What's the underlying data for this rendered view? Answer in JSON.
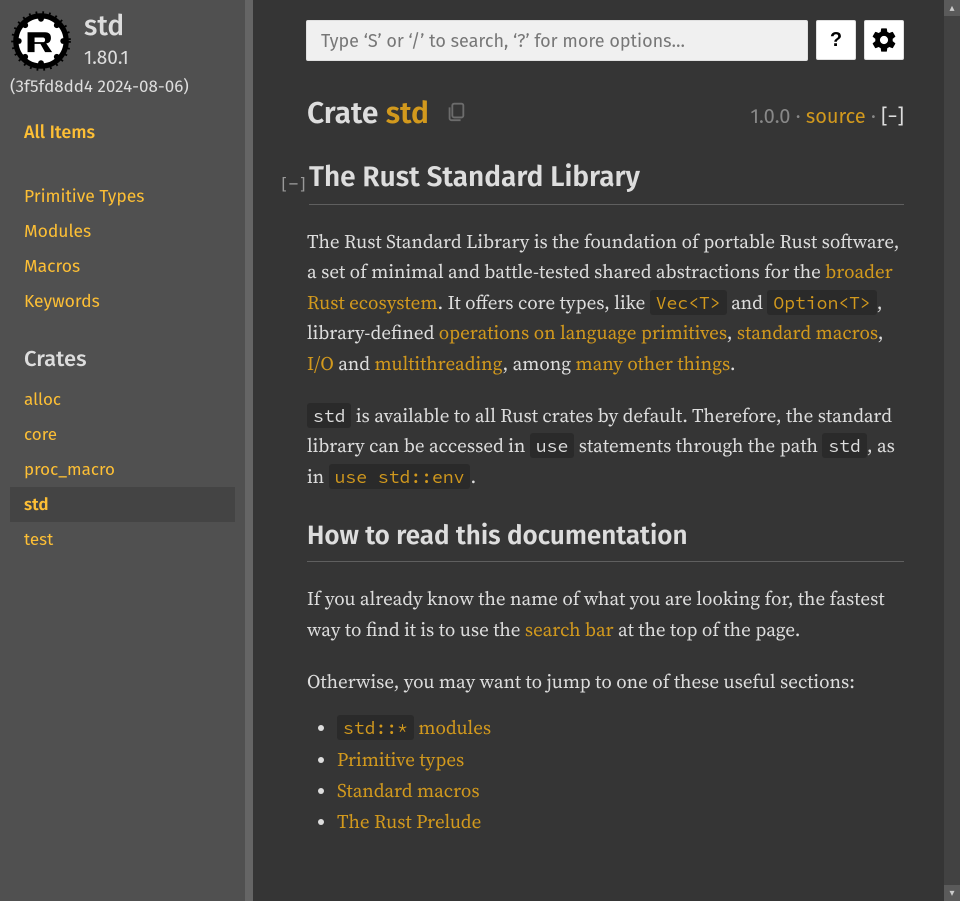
{
  "sidebar": {
    "crate_name": "std",
    "version": "1.80.1",
    "hash": "(3f5fd8dd4 2024-08-06)",
    "all_items": "All Items",
    "nav": [
      "Primitive Types",
      "Modules",
      "Macros",
      "Keywords"
    ],
    "crates_heading": "Crates",
    "crates": [
      {
        "name": "alloc",
        "current": false
      },
      {
        "name": "core",
        "current": false
      },
      {
        "name": "proc_macro",
        "current": false
      },
      {
        "name": "std",
        "current": true
      },
      {
        "name": "test",
        "current": false
      }
    ]
  },
  "topbar": {
    "search_placeholder": "Type ‘S’ or ‘/’ to search, ‘?’ for more options…",
    "help_label": "?"
  },
  "header": {
    "crate_word": "Crate",
    "crate_name": "std",
    "version": "1.0.0",
    "sep": " · ",
    "source": "source",
    "toggle": "[−]"
  },
  "doc": {
    "h1": "The Rust Standard Library",
    "p1a": "The Rust Standard Library is the foundation of portable Rust software, a set of minimal and battle-tested shared abstractions for the ",
    "link_ecosystem": "broader Rust ecosystem",
    "p1b": ". It offers core types, like ",
    "code_vec": "Vec<T>",
    "and1": " and ",
    "code_option": "Option<T>",
    "p1c": ", library-defined ",
    "link_ops": "operations on language primitives",
    "comma1": ", ",
    "link_macros": "standard macros",
    "comma2": ", ",
    "link_io": "I/O",
    "and2": " and ",
    "link_threads": "multithreading",
    "p1d": ", among ",
    "link_many": "many other things",
    "p1e": ".",
    "p2a_code": "std",
    "p2a": " is available to all Rust crates by default. Therefore, the standard library can be accessed in ",
    "p2_use": "use",
    "p2b": " statements through the path ",
    "p2_std": "std",
    "p2c": ", as in ",
    "p2_usestd": "use std::env",
    "p2d": ".",
    "h2": "How to read this documentation",
    "p3a": "If you already know the name of what you are looking for, the fastest way to find it is to use the ",
    "link_search": "search bar",
    "p3b": " at the top of the page.",
    "p4": "Otherwise, you may want to jump to one of these useful sections:",
    "list": [
      {
        "code": "std::*",
        "suffix": " modules"
      },
      {
        "text": "Primitive types"
      },
      {
        "text": "Standard macros"
      },
      {
        "text": "The Rust Prelude"
      }
    ]
  }
}
